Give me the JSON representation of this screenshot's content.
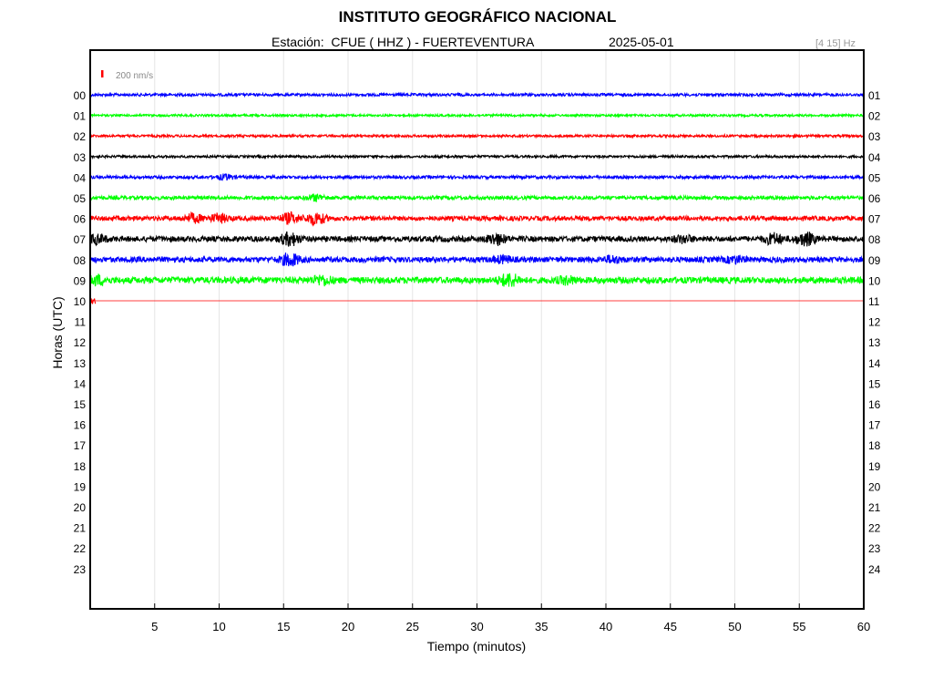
{
  "header": {
    "title": "INSTITUTO GEOGRÁFICO NACIONAL",
    "station_line": "Estación:  CFUE ( HHZ ) - FUERTEVENTURA",
    "date": "2025-05-01",
    "filter": "[4 15] Hz"
  },
  "chart_data": {
    "type": "line",
    "xlabel": "Tiempo (minutos)",
    "ylabel": "Horas (UTC)",
    "xlim": [
      0,
      60
    ],
    "x_ticks": [
      5,
      10,
      15,
      20,
      25,
      30,
      35,
      40,
      45,
      50,
      55,
      60
    ],
    "grid": "vertical",
    "scale_bar_label": "200 nm/s",
    "scale_bar_color": "#ff0000",
    "left_hour_labels": [
      "00",
      "01",
      "02",
      "03",
      "04",
      "05",
      "06",
      "07",
      "08",
      "09",
      "10",
      "11",
      "12",
      "13",
      "14",
      "15",
      "16",
      "17",
      "18",
      "19",
      "20",
      "21",
      "22",
      "23"
    ],
    "right_hour_labels": [
      "01",
      "02",
      "03",
      "04",
      "05",
      "06",
      "07",
      "08",
      "09",
      "10",
      "11",
      "12",
      "13",
      "14",
      "15",
      "16",
      "17",
      "18",
      "19",
      "20",
      "21",
      "22",
      "23",
      "24"
    ],
    "trace_colors": [
      "#0000ff",
      "#00ff00",
      "#ff0000",
      "#000000"
    ],
    "traces": [
      {
        "hour": "00",
        "end_minute": 60,
        "noise_level": 1.5,
        "bursts": []
      },
      {
        "hour": "01",
        "end_minute": 60,
        "noise_level": 1.2,
        "bursts": []
      },
      {
        "hour": "02",
        "end_minute": 60,
        "noise_level": 1.3,
        "bursts": []
      },
      {
        "hour": "03",
        "end_minute": 60,
        "noise_level": 1.3,
        "bursts": []
      },
      {
        "hour": "04",
        "end_minute": 60,
        "noise_level": 1.6,
        "bursts": [
          [
            10.5,
            2.5
          ]
        ]
      },
      {
        "hour": "05",
        "end_minute": 60,
        "noise_level": 2.0,
        "bursts": [
          [
            17.5,
            3
          ]
        ]
      },
      {
        "hour": "06",
        "end_minute": 60,
        "noise_level": 2.5,
        "bursts": [
          [
            8,
            4
          ],
          [
            10,
            4
          ],
          [
            15.5,
            5
          ],
          [
            17.5,
            6
          ]
        ]
      },
      {
        "hour": "07",
        "end_minute": 60,
        "noise_level": 3.0,
        "bursts": [
          [
            0.5,
            4
          ],
          [
            15.5,
            6
          ],
          [
            31.5,
            5
          ],
          [
            46,
            3
          ],
          [
            53,
            5
          ],
          [
            55.5,
            6
          ]
        ]
      },
      {
        "hour": "08",
        "end_minute": 60,
        "noise_level": 3.0,
        "bursts": [
          [
            15.5,
            6
          ],
          [
            32,
            3
          ],
          [
            40.5,
            3
          ],
          [
            50,
            3
          ]
        ]
      },
      {
        "hour": "09",
        "end_minute": 60,
        "noise_level": 3.5,
        "bursts": [
          [
            0.5,
            4
          ],
          [
            18,
            4
          ],
          [
            32.5,
            6
          ],
          [
            37,
            3
          ]
        ]
      },
      {
        "hour": "10",
        "end_minute": 0.4,
        "noise_level": 3.5,
        "bursts": []
      }
    ]
  }
}
